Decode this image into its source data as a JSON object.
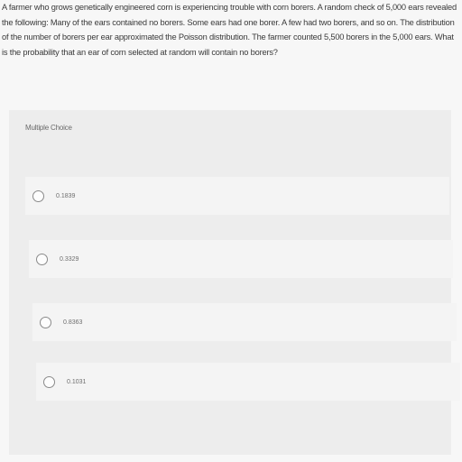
{
  "question": {
    "text": "A farmer who grows genetically engineered corn is experiencing trouble with corn borers. A random check of 5,000 ears revealed the following: Many of the ears contained no borers. Some ears had one borer. A few had two borers, and so on. The distribution of the number of borers per ear approximated the Poisson distribution. The farmer counted 5,500 borers in the 5,000 ears. What is the probability that an ear of corn selected at random will contain no borers?"
  },
  "panel": {
    "type_label": "Multiple Choice",
    "options": [
      {
        "label": "0.1839"
      },
      {
        "label": "0.3329"
      },
      {
        "label": "0.8363"
      },
      {
        "label": "0.1031"
      }
    ]
  }
}
